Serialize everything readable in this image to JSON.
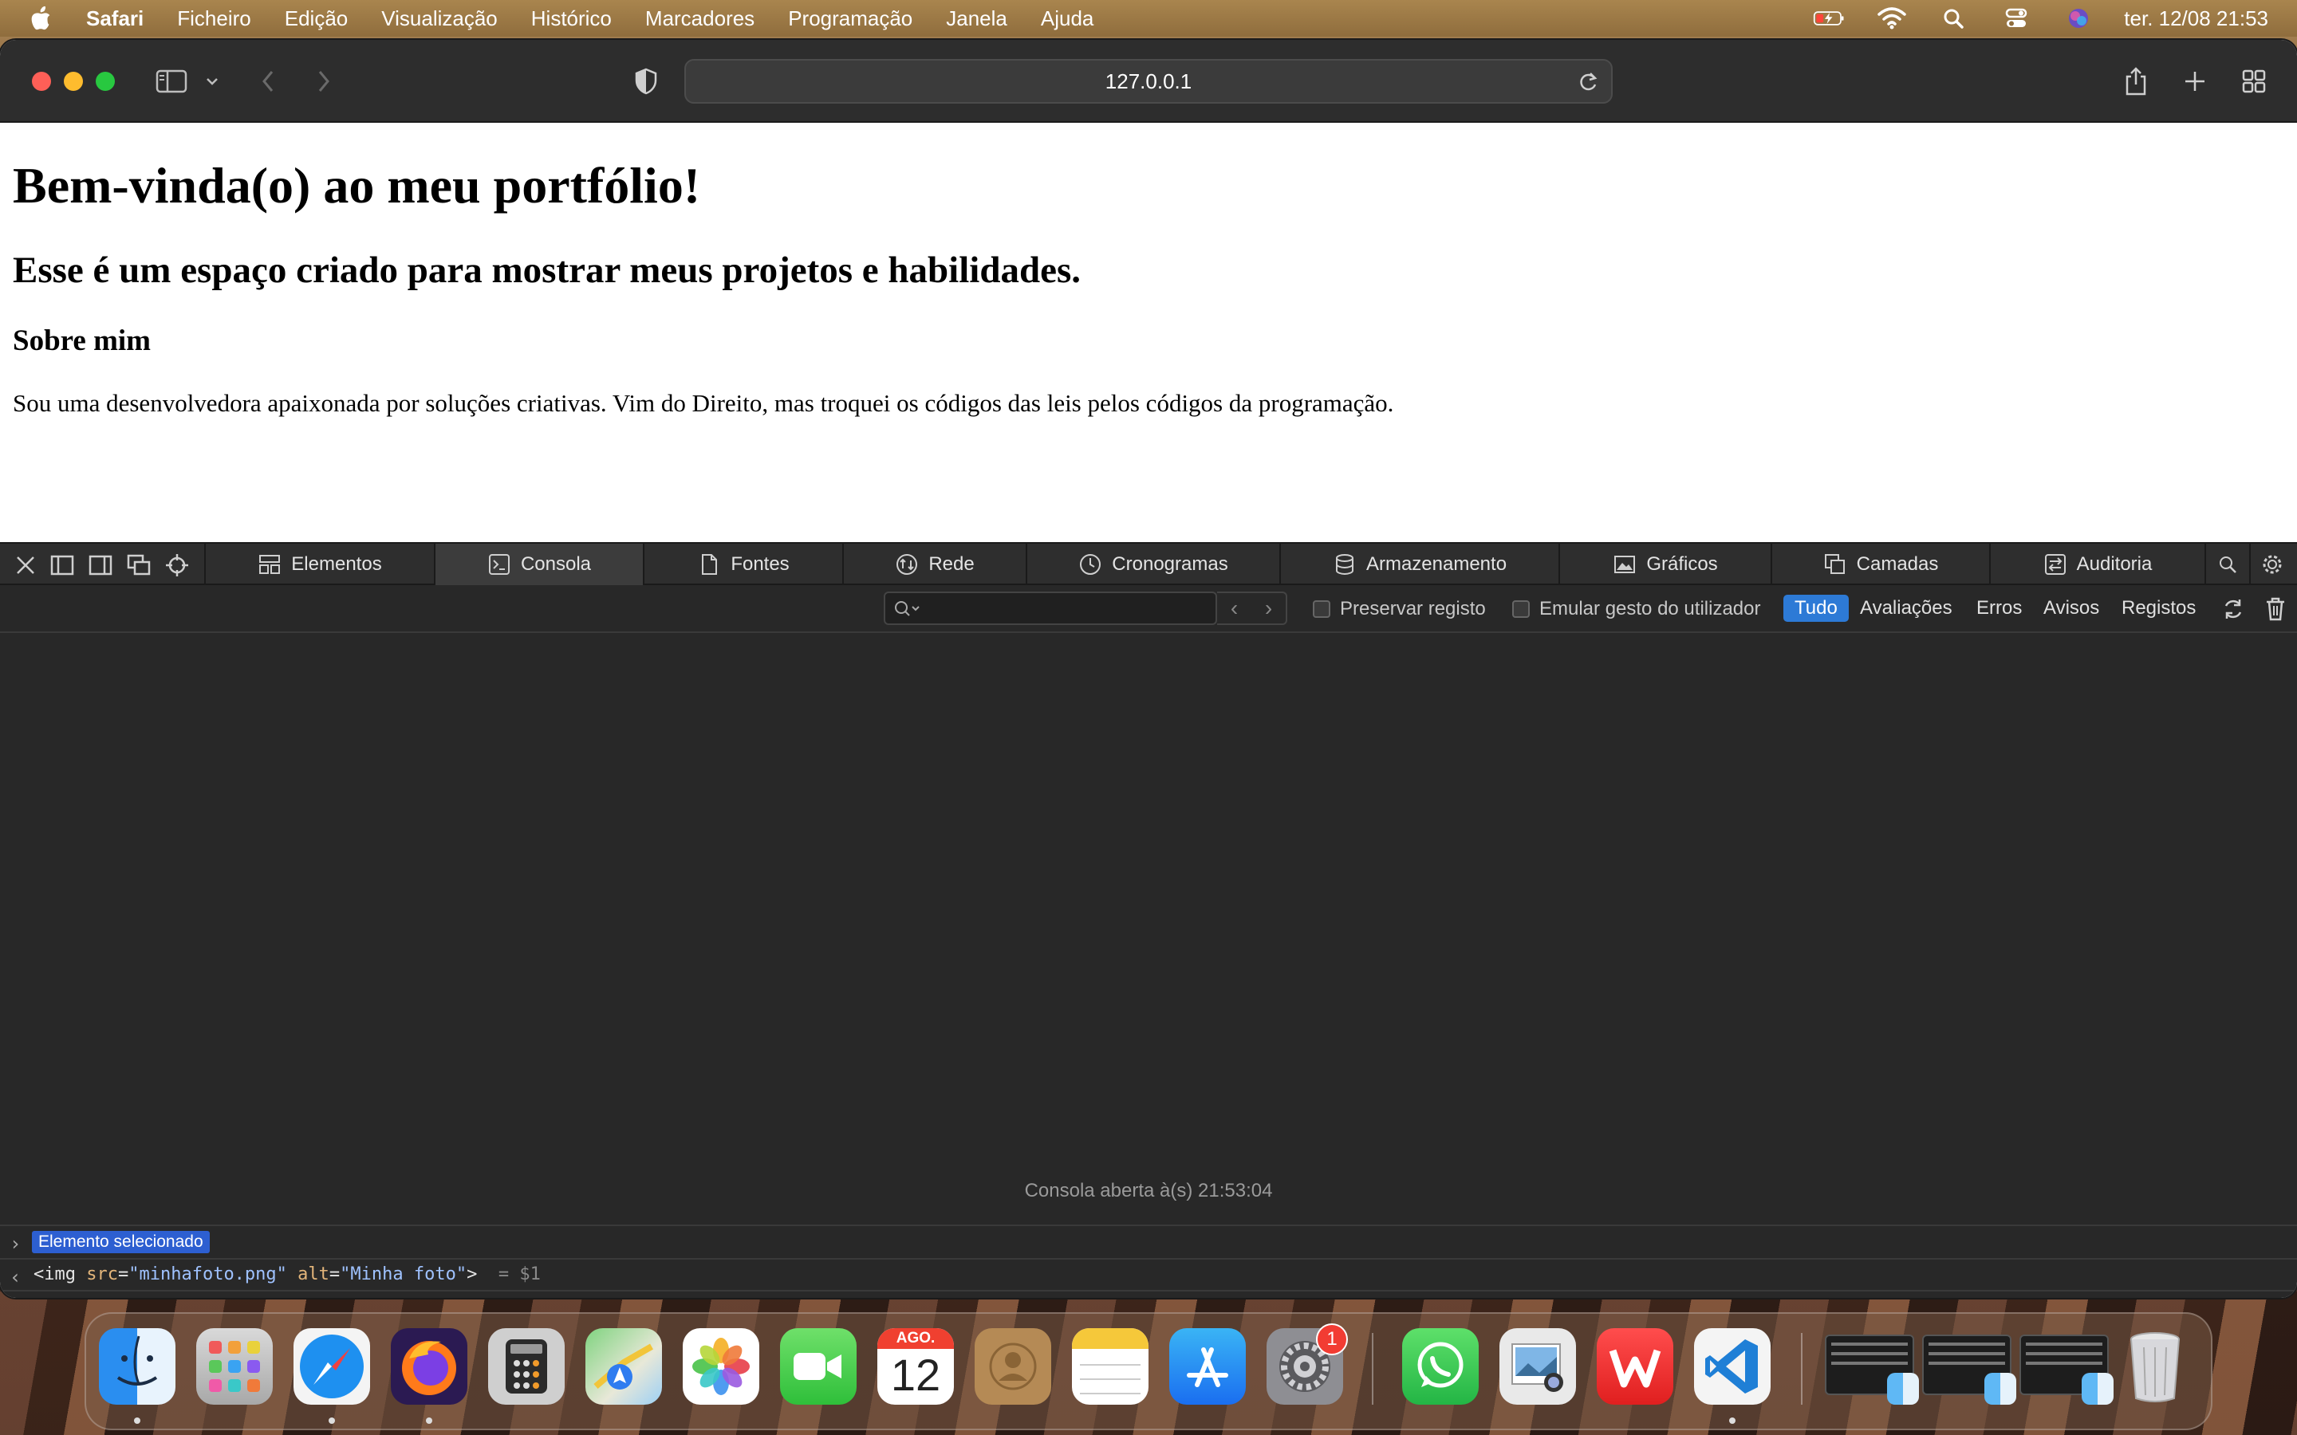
{
  "menubar": {
    "app_name": "Safari",
    "items": [
      "Ficheiro",
      "Edição",
      "Visualização",
      "Histórico",
      "Marcadores",
      "Programação",
      "Janela",
      "Ajuda"
    ],
    "clock": "ter. 12/08  21:53",
    "status_icons": [
      "battery-charging-icon",
      "wifi-icon",
      "spotlight-search-icon",
      "control-center-icon",
      "siri-icon"
    ]
  },
  "browser": {
    "url": "127.0.0.1"
  },
  "page": {
    "heading": "Bem-vinda(o) ao meu portfólio!",
    "subheading": "Esse é um espaço criado para mostrar meus projetos e habilidades.",
    "section_title": "Sobre mim",
    "paragraph": "Sou uma desenvolvedora apaixonada por soluções criativas. Vim do Direito, mas troquei os códigos das leis pelos códigos da programação."
  },
  "inspector": {
    "tabs": [
      {
        "label": "Elementos",
        "icon": "elements-icon"
      },
      {
        "label": "Consola",
        "icon": "console-icon",
        "active": true
      },
      {
        "label": "Fontes",
        "icon": "sources-icon"
      },
      {
        "label": "Rede",
        "icon": "network-icon"
      },
      {
        "label": "Cronogramas",
        "icon": "timelines-icon"
      },
      {
        "label": "Armazenamento",
        "icon": "storage-icon"
      },
      {
        "label": "Gráficos",
        "icon": "graphics-icon"
      },
      {
        "label": "Camadas",
        "icon": "layers-icon"
      },
      {
        "label": "Auditoria",
        "icon": "audit-icon"
      }
    ],
    "filter": {
      "placeholder": "",
      "preserve_log": "Preservar registo",
      "emulate_gesture": "Emular gesto do utilizador",
      "levels": [
        "Tudo",
        "Avaliações",
        "Erros",
        "Avisos",
        "Registos"
      ],
      "active_level": "Tudo"
    },
    "console": {
      "opened_message": "Consola aberta à(s) 21:53:04",
      "selected_badge": "Elemento selecionado",
      "img_tag_open": "<img ",
      "attr_src_name": "src",
      "attr_src_value": "\"minhafoto.png\"",
      "attr_alt_name": "alt",
      "attr_alt_value": "\"Minha foto\"",
      "img_tag_close": ">",
      "ref": "= $1"
    }
  },
  "dock": {
    "apps": [
      "Finder",
      "Launchpad",
      "Safari",
      "Firefox",
      "Calculadora",
      "Mapas",
      "Fotografias",
      "FaceTime",
      "Calendário",
      "Contactos",
      "Notas",
      "App Store",
      "Definições do Sistema",
      "WhatsApp",
      "Pré-visualização",
      "WPS Office",
      "Visual Studio Code"
    ],
    "calendar_month": "AGO.",
    "calendar_day": "12",
    "settings_badge": "1"
  }
}
